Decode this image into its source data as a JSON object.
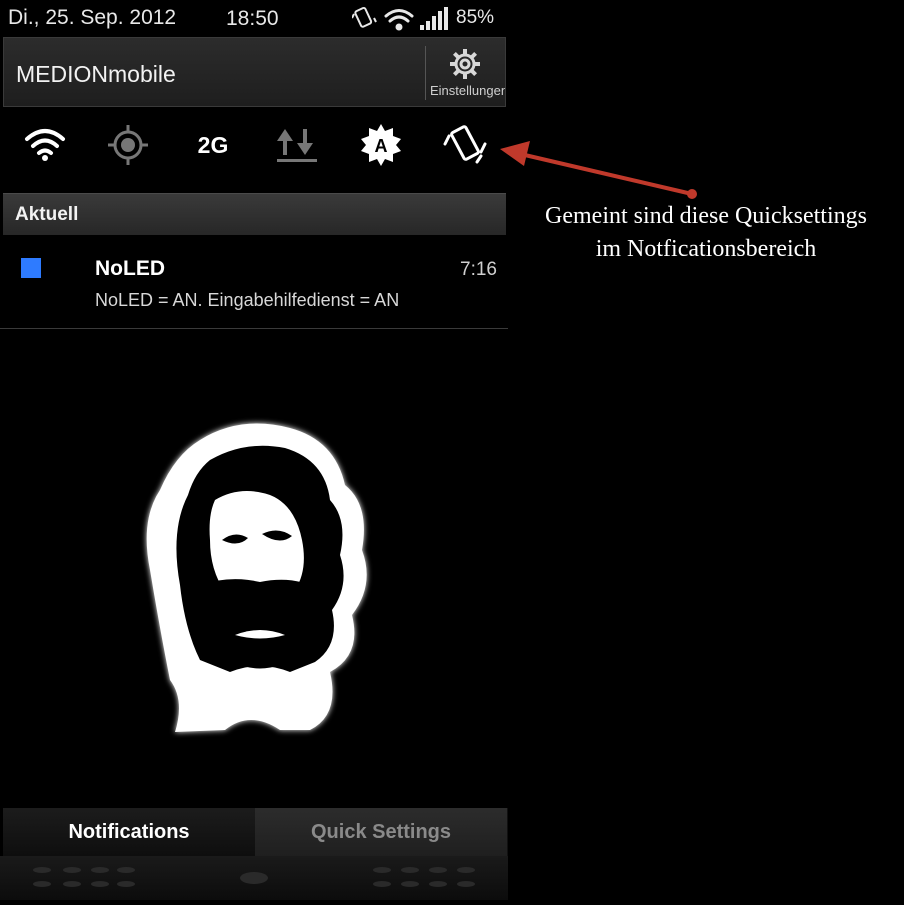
{
  "status_bar": {
    "date": "Di., 25. Sep. 2012",
    "time": "18:50",
    "battery": "85%",
    "icons": [
      "vibrate-icon",
      "wifi-icon",
      "signal-icon"
    ]
  },
  "carrier_bar": {
    "carrier": "MEDIONmobile",
    "settings_label": "Einstellungen"
  },
  "quick_settings": [
    {
      "name": "wifi-toggle",
      "icon": "wifi-icon"
    },
    {
      "name": "gps-toggle",
      "icon": "gps-icon"
    },
    {
      "name": "network-toggle",
      "label": "2G",
      "icon": "2g-icon"
    },
    {
      "name": "data-toggle",
      "icon": "data-transfer-icon"
    },
    {
      "name": "brightness-toggle",
      "icon": "auto-brightness-icon"
    },
    {
      "name": "rotation-toggle",
      "icon": "auto-rotate-icon"
    }
  ],
  "section": {
    "title": "Aktuell"
  },
  "notification": {
    "title": "NoLED",
    "time": "7:16",
    "text": "NoLED = AN. Eingabehilfedienst = AN",
    "color": "#2e7bff"
  },
  "tabs": {
    "notifications": "Notifications",
    "quick_settings": "Quick Settings"
  },
  "annotation": {
    "line1": "Gemeint sind diese Quicksettings",
    "line2": "im Notficationsbereich",
    "arrow_color": "#c0392b"
  }
}
